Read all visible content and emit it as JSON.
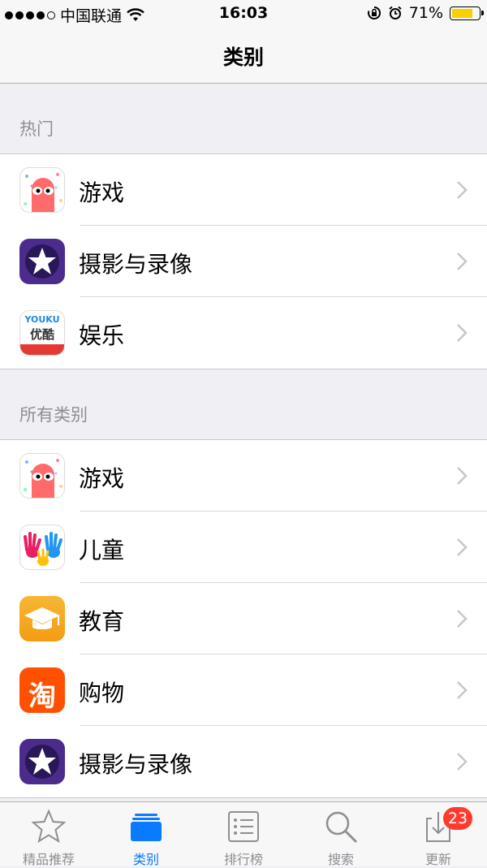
{
  "status_bar": {
    "carrier": "中国联通",
    "time": "16:03",
    "battery": "71%"
  },
  "nav": {
    "title": "类别"
  },
  "sections": [
    {
      "header": "热门",
      "items": [
        {
          "label": "游戏",
          "icon": "game-monster-icon"
        },
        {
          "label": "摄影与录像",
          "icon": "imovie-star-icon"
        },
        {
          "label": "娱乐",
          "icon": "youku-icon",
          "icon_text_1": "YOUKU",
          "icon_text_2": "优酷"
        }
      ]
    },
    {
      "header": "所有类别",
      "items": [
        {
          "label": "游戏",
          "icon": "game-monster-icon"
        },
        {
          "label": "儿童",
          "icon": "kids-hands-icon"
        },
        {
          "label": "教育",
          "icon": "graduation-cap-icon"
        },
        {
          "label": "购物",
          "icon": "taobao-icon",
          "icon_text": "淘"
        },
        {
          "label": "摄影与录像",
          "icon": "imovie-star-icon"
        }
      ]
    }
  ],
  "tabbar": {
    "items": [
      {
        "label": "精品推荐",
        "icon": "star-icon"
      },
      {
        "label": "类别",
        "icon": "categories-icon",
        "active": true
      },
      {
        "label": "排行榜",
        "icon": "list-icon"
      },
      {
        "label": "搜索",
        "icon": "search-icon"
      },
      {
        "label": "更新",
        "icon": "update-icon",
        "badge": "23"
      }
    ]
  },
  "colors": {
    "accent": "#0a7aff",
    "badge": "#ff3b30",
    "battery": "#f8d000",
    "imovie": "#4b2c8c",
    "education": "#f39c12",
    "taobao": "#ff5000"
  }
}
